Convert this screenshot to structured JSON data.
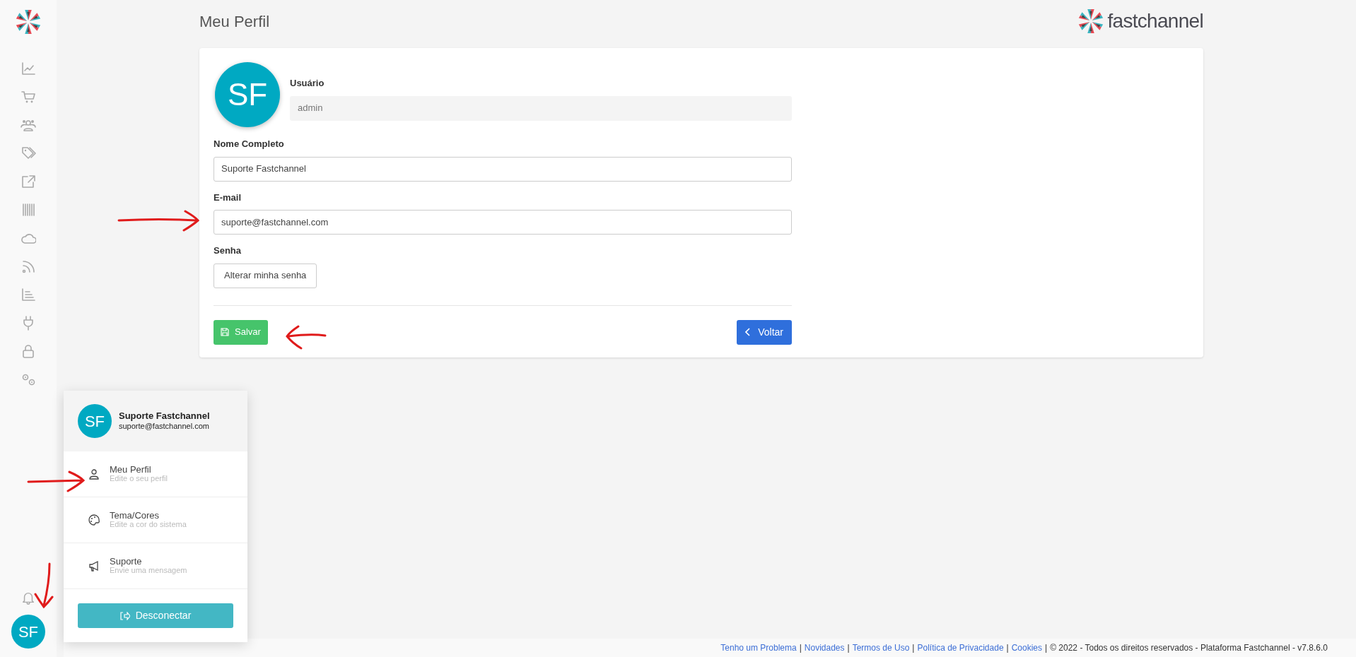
{
  "sidebar": {
    "avatar_initials": "SF"
  },
  "header": {
    "title": "Meu Perfil",
    "brand": "fastchannel"
  },
  "profile_form": {
    "avatar_initials": "SF",
    "fields": [
      {
        "kind": "readonly",
        "label": "Usuário",
        "value": "admin"
      },
      {
        "kind": "text",
        "label": "Nome Completo",
        "value": "Suporte Fastchannel"
      },
      {
        "kind": "text",
        "label": "E-mail",
        "value": "suporte@fastchannel.com"
      },
      {
        "kind": "button",
        "label": "Senha",
        "value": "Alterar minha senha"
      }
    ],
    "save_button": "Salvar",
    "back_button": "Voltar"
  },
  "user_menu": {
    "avatar_initials": "SF",
    "name": "Suporte Fastchannel",
    "email": "suporte@fastchannel.com",
    "items": [
      {
        "kind": "profile",
        "title": "Meu Perfil",
        "subtitle": "Edite o seu perfil"
      },
      {
        "kind": "theme",
        "title": "Tema/Cores",
        "subtitle": "Edite a cor do sistema"
      },
      {
        "kind": "support",
        "title": "Suporte",
        "subtitle": "Envie uma mensagem"
      }
    ],
    "logout_button": "Desconectar"
  },
  "footer": {
    "links": [
      "Tenho um Problema",
      "Novidades",
      "Termos de Uso",
      "Política de Privacidade",
      "Cookies"
    ],
    "separator": "|",
    "text": "© 2022 - Todos os direitos reservados - Plataforma Fastchannel - v7.8.6.0"
  }
}
